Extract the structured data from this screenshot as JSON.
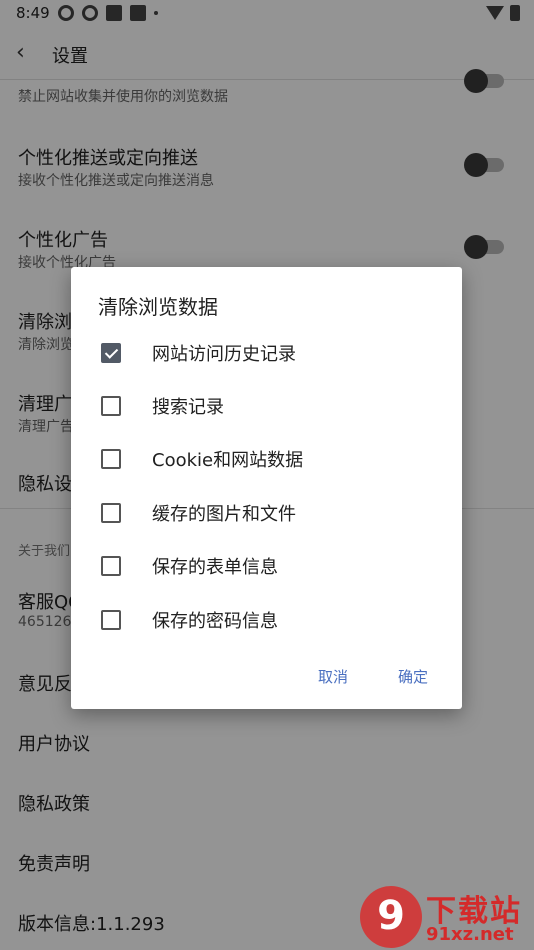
{
  "status_bar": {
    "time": "8:49"
  },
  "app_bar": {
    "title": "设置"
  },
  "settings": [
    {
      "title": "",
      "subtitle": "禁止网站收集并使用你的浏览数据",
      "has_switch": true
    },
    {
      "title": "个性化推送或定向推送",
      "subtitle": "接收个性化推送或定向推送消息",
      "has_switch": true
    },
    {
      "title": "个性化广告",
      "subtitle": "接收个性化广告",
      "has_switch": true
    },
    {
      "title": "清除浏",
      "subtitle": "清除浏览"
    },
    {
      "title": "清理广",
      "subtitle": "清理广告"
    },
    {
      "title": "隐私设"
    }
  ],
  "about": {
    "section_label": "关于我们",
    "items": [
      {
        "title": "客服QQ",
        "subtitle": "465126"
      },
      {
        "title": "意见反"
      },
      {
        "title": "用户协议"
      },
      {
        "title": "隐私政策"
      },
      {
        "title": "免责声明"
      },
      {
        "title": "版本信息:1.1.293"
      }
    ]
  },
  "dialog": {
    "title": "清除浏览数据",
    "options": [
      {
        "label": "网站访问历史记录",
        "checked": true
      },
      {
        "label": "搜索记录",
        "checked": false
      },
      {
        "label": "Cookie和网站数据",
        "checked": false
      },
      {
        "label": "缓存的图片和文件",
        "checked": false
      },
      {
        "label": "保存的表单信息",
        "checked": false
      },
      {
        "label": "保存的密码信息",
        "checked": false
      }
    ],
    "cancel_label": "取消",
    "confirm_label": "确定"
  },
  "watermark": {
    "logo_text": "9",
    "brand": "下载站",
    "url": "91xz.net"
  },
  "colors": {
    "accent": "#4a6fc0",
    "checkbox_checked": "#525a66",
    "scrim": "rgba(0,0,0,0.42)"
  },
  "icons": {
    "back": "chevron-left-icon"
  }
}
